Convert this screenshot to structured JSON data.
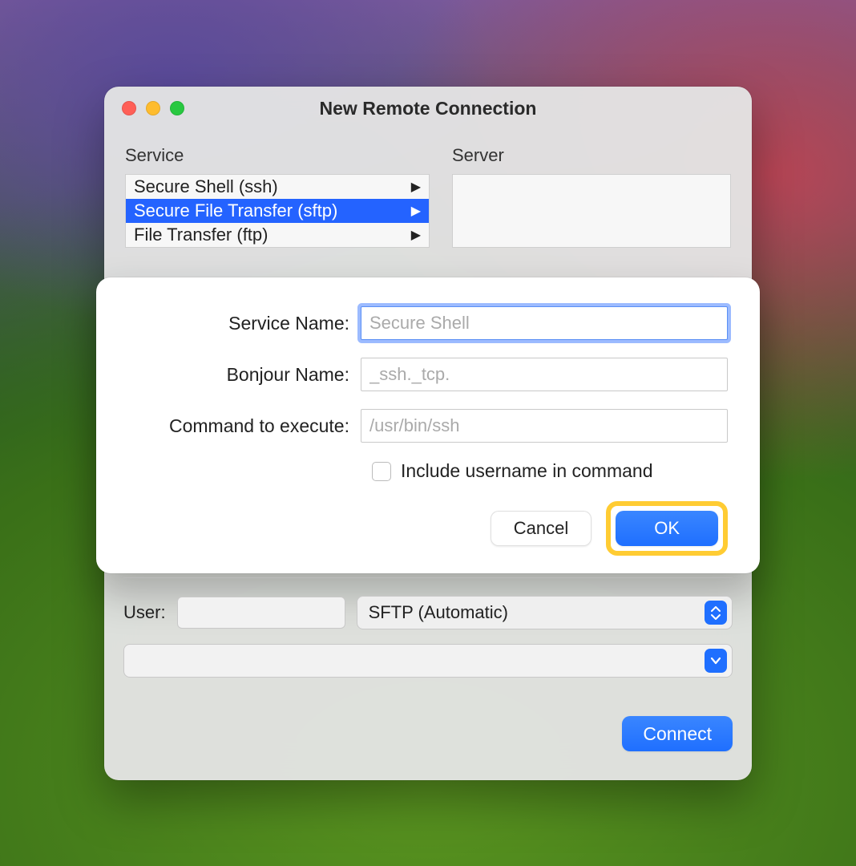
{
  "window": {
    "title": "New Remote Connection"
  },
  "columns": {
    "service_header": "Service",
    "server_header": "Server",
    "services": [
      {
        "label": "Secure Shell (ssh)"
      },
      {
        "label": "Secure File Transfer (sftp)"
      },
      {
        "label": "File Transfer (ftp)"
      }
    ]
  },
  "sheet": {
    "service_name_label": "Service Name:",
    "service_name_placeholder": "Secure Shell",
    "bonjour_label": "Bonjour Name:",
    "bonjour_placeholder": "_ssh._tcp.",
    "command_label": "Command to execute:",
    "command_placeholder": "/usr/bin/ssh",
    "include_username_label": "Include username in command",
    "cancel_label": "Cancel",
    "ok_label": "OK"
  },
  "lower": {
    "user_label": "User:",
    "scheme_label": "SFTP (Automatic)",
    "connect_label": "Connect"
  }
}
